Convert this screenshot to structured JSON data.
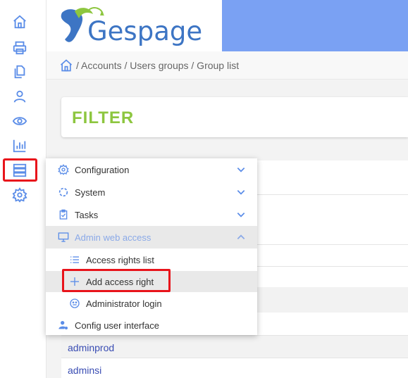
{
  "app": {
    "logo_text": "Gespage"
  },
  "sidebar": {
    "items": [
      {
        "name": "home-icon"
      },
      {
        "name": "printer-icon"
      },
      {
        "name": "documents-icon"
      },
      {
        "name": "user-icon"
      },
      {
        "name": "eye-icon"
      },
      {
        "name": "chart-icon"
      },
      {
        "name": "server-icon",
        "selected": true
      },
      {
        "name": "gear-icon"
      }
    ]
  },
  "breadcrumb": {
    "text": "/ Accounts / Users groups / Group list"
  },
  "filter": {
    "title": "FILTER"
  },
  "groups": [
    "adminprod",
    "adminsi"
  ],
  "menu": {
    "items": [
      {
        "label": "Configuration",
        "icon": "gear-icon",
        "chevron": "down"
      },
      {
        "label": "System",
        "icon": "circle-dots-icon",
        "chevron": "down"
      },
      {
        "label": "Tasks",
        "icon": "clipboard-icon",
        "chevron": "down"
      },
      {
        "label": "Admin web access",
        "icon": "monitor-icon",
        "chevron": "up",
        "active": true
      },
      {
        "label": "Access rights list",
        "icon": "list-icon",
        "sub": true
      },
      {
        "label": "Add access right",
        "icon": "plus-icon",
        "sub": true,
        "hover": true
      },
      {
        "label": "Administrator login",
        "icon": "face-icon",
        "sub": true
      },
      {
        "label": "Config user interface",
        "icon": "user-settings-icon"
      }
    ]
  },
  "colors": {
    "accent_blue": "#7aa1f3",
    "icon_blue": "#3d75c4",
    "filter_green": "#8dc63f",
    "highlight_red": "#e8141b",
    "link_blue": "#3a4db3"
  }
}
